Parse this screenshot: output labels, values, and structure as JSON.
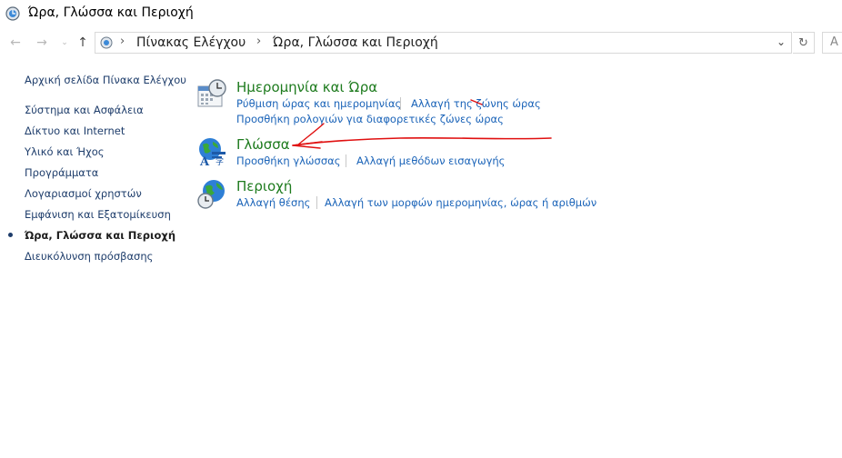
{
  "window": {
    "title": "Ώρα, Γλώσσα και Περιοχή",
    "app_icon": "clock-globe-icon"
  },
  "address_bar": {
    "breadcrumbs": [
      "Πίνακας Ελέγχου",
      "Ώρα, Γλώσσα και Περιοχή"
    ],
    "search_placeholder_partial": "Α"
  },
  "sidebar": {
    "items": [
      {
        "label": "Αρχική σελίδα Πίνακα Ελέγχου",
        "current": false
      },
      {
        "label": "Σύστημα και Ασφάλεια",
        "current": false
      },
      {
        "label": "Δίκτυο και Internet",
        "current": false
      },
      {
        "label": "Υλικό και Ήχος",
        "current": false
      },
      {
        "label": "Προγράμματα",
        "current": false
      },
      {
        "label": "Λογαριασμοί χρηστών",
        "current": false
      },
      {
        "label": "Εμφάνιση και Εξατομίκευση",
        "current": false
      },
      {
        "label": "Ώρα, Γλώσσα και Περιοχή",
        "current": true
      },
      {
        "label": "Διευκόλυνση πρόσβασης",
        "current": false
      }
    ]
  },
  "categories": [
    {
      "title": "Ημερομηνία και Ώρα",
      "icon": "calendar-clock-icon",
      "links": [
        "Ρύθμιση ώρας και ημερομηνίας",
        "Αλλαγή της ζώνης ώρας",
        "Προσθήκη ρολογιών για διαφορετικές ζώνες ώρας"
      ]
    },
    {
      "title": "Γλώσσα",
      "icon": "language-globe-icon",
      "links": [
        "Προσθήκη γλώσσας",
        "Αλλαγή μεθόδων εισαγωγής"
      ]
    },
    {
      "title": "Περιοχή",
      "icon": "region-globe-clock-icon",
      "links": [
        "Αλλαγή θέσης",
        "Αλλαγή των μορφών ημερομηνίας, ώρας ή αριθμών"
      ]
    }
  ],
  "annotation": {
    "color": "#e01010",
    "icon": "red-hand-drawn-arrow"
  }
}
